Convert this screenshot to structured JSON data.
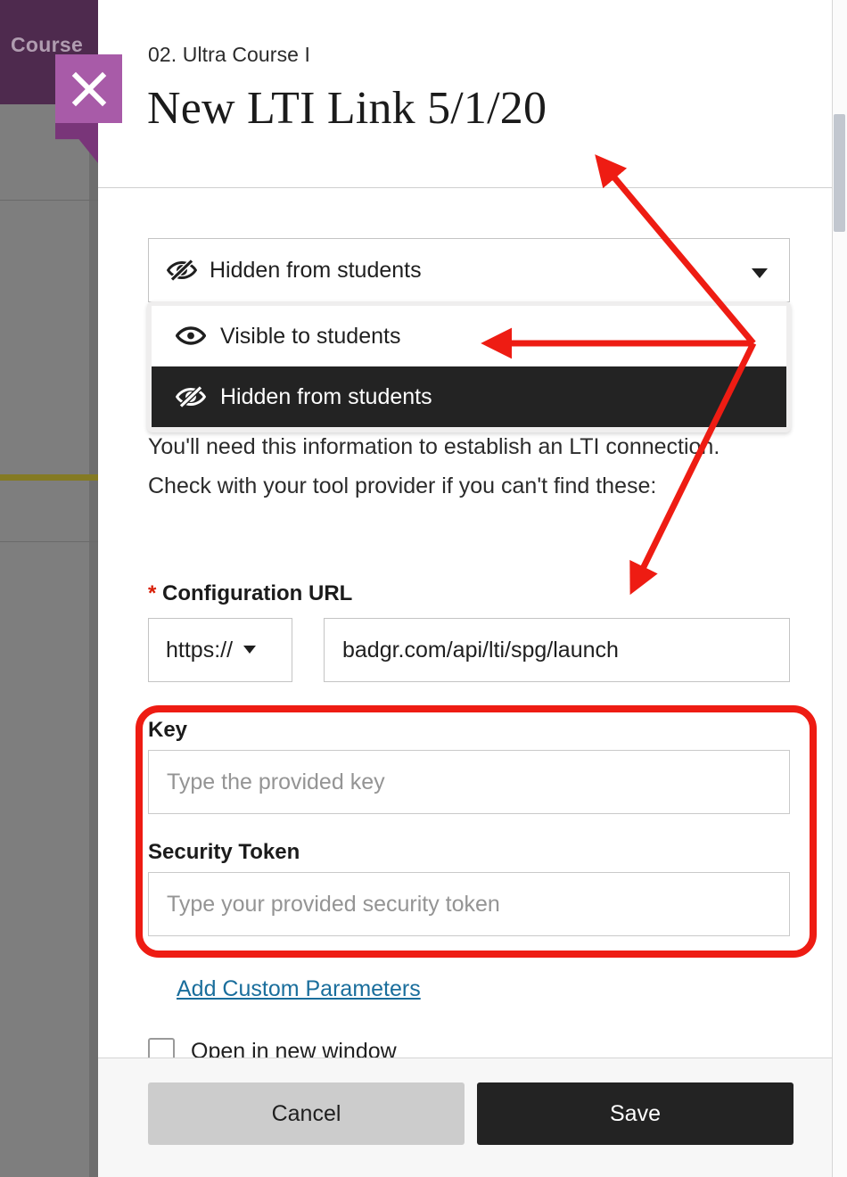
{
  "background": {
    "course_label": "Course",
    "purple_bar_color": "#4e2a4e",
    "grey_color": "#7e7e7e",
    "gold_line_color": "#847a23"
  },
  "close_button": {
    "name": "close-panel",
    "icon": "close-x-icon",
    "color": "#a85ba8",
    "tail_color": "#793579"
  },
  "header": {
    "breadcrumb": "02. Ultra Course I",
    "title": "New LTI Link 5/1/20"
  },
  "visibility": {
    "selected_label": "Hidden from students",
    "selected_icon": "eye-slash-icon",
    "caret_icon": "chevron-down-icon",
    "options": [
      {
        "label": "Visible to students",
        "icon": "eye-icon",
        "selected": false
      },
      {
        "label": "Hidden from students",
        "icon": "eye-slash-icon",
        "selected": true
      }
    ]
  },
  "body": {
    "helper_text": "You'll need this information to establish an LTI connection. Check with your tool provider if you can't find these:",
    "config_url": {
      "required_marker": "*",
      "label": "Configuration URL",
      "protocol_value": "https://",
      "protocol_caret_icon": "chevron-down-icon",
      "url_value": "badgr.com/api/lti/spg/launch"
    },
    "key": {
      "label": "Key",
      "value": "",
      "placeholder": "Type the provided key"
    },
    "security_token": {
      "label": "Security Token",
      "value": "",
      "placeholder": "Type your provided security token"
    },
    "add_custom_parameters_link": "Add Custom Parameters",
    "open_in_new_window": {
      "label": "Open in new window",
      "checked": false
    }
  },
  "footer": {
    "cancel_label": "Cancel",
    "save_label": "Save"
  },
  "annotations": {
    "highlight_color": "#ee1c13",
    "highlight_box_target": "key-and-security-token-fields",
    "arrow_count": 3
  }
}
